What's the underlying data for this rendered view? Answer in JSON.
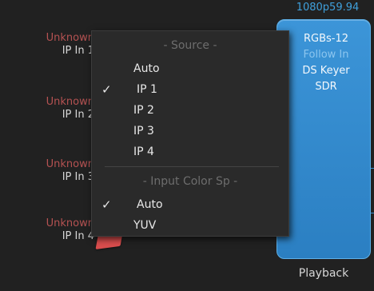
{
  "inputs": [
    {
      "status": "Unknown",
      "name": "IP In 1"
    },
    {
      "status": "Unknown",
      "name": "IP In 2"
    },
    {
      "status": "Unknown",
      "name": "IP In 3"
    },
    {
      "status": "Unknown",
      "name": "IP In 4"
    }
  ],
  "output": {
    "format": "1080p59.94",
    "lines": [
      "RGBs-12",
      "Follow In",
      "DS Keyer",
      "SDR"
    ],
    "label": "Playback"
  },
  "menu": {
    "source_header": "- Source -",
    "source_items": [
      {
        "label": "Auto",
        "checked": false
      },
      {
        "label": "IP 1",
        "checked": true
      },
      {
        "label": "IP 2",
        "checked": false
      },
      {
        "label": "IP 3",
        "checked": false
      },
      {
        "label": "IP 4",
        "checked": false
      }
    ],
    "color_header": "- Input Color Sp -",
    "color_items": [
      {
        "label": "Auto",
        "checked": true
      },
      {
        "label": "YUV",
        "checked": false
      }
    ],
    "check_glyph": "✓"
  },
  "colors": {
    "status_unknown": "#b55252",
    "card_blue": "#3c95d8",
    "format_blue": "#3fa0dc"
  }
}
